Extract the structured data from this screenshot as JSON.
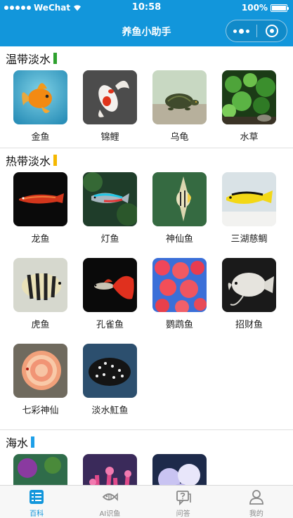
{
  "status_bar": {
    "carrier": "WeChat",
    "time": "10:58",
    "battery": "100%"
  },
  "nav": {
    "title": "养鱼小助手"
  },
  "sections": [
    {
      "title": "温带淡水",
      "bar_color": "#2ea12e",
      "items": [
        {
          "label": "金鱼",
          "icon": "goldfish-image"
        },
        {
          "label": "锦鲤",
          "icon": "koi-image"
        },
        {
          "label": "乌龟",
          "icon": "turtle-image"
        },
        {
          "label": "水草",
          "icon": "aquatic-plants-image"
        }
      ]
    },
    {
      "title": "热带淡水",
      "bar_color": "#f5b800",
      "items": [
        {
          "label": "龙鱼",
          "icon": "arowana-image"
        },
        {
          "label": "灯鱼",
          "icon": "tetra-image"
        },
        {
          "label": "神仙鱼",
          "icon": "angelfish-image"
        },
        {
          "label": "三湖慈鲷",
          "icon": "cichlid-image"
        },
        {
          "label": "虎鱼",
          "icon": "tiger-fish-image"
        },
        {
          "label": "孔雀鱼",
          "icon": "guppy-image"
        },
        {
          "label": "鹦鹉鱼",
          "icon": "parrot-fish-image"
        },
        {
          "label": "招财鱼",
          "icon": "gourami-image"
        },
        {
          "label": "七彩神仙",
          "icon": "discus-image"
        },
        {
          "label": "淡水魟鱼",
          "icon": "stingray-image"
        }
      ]
    },
    {
      "title": "海水",
      "bar_color": "#1e9fe8",
      "items": [
        {
          "label": "",
          "icon": "clownfish-image"
        },
        {
          "label": "",
          "icon": "coral-image"
        },
        {
          "label": "",
          "icon": "anemone-image"
        }
      ]
    }
  ],
  "tabs": [
    {
      "label": "百科",
      "icon": "encyclopedia-icon",
      "active": true
    },
    {
      "label": "AI识鱼",
      "icon": "fish-scan-icon",
      "active": false
    },
    {
      "label": "问答",
      "icon": "qa-icon",
      "active": false
    },
    {
      "label": "我的",
      "icon": "profile-icon",
      "active": false
    }
  ],
  "colors": {
    "brand": "#1296db",
    "tab_active": "#1296db",
    "tab_inactive": "#888888"
  }
}
